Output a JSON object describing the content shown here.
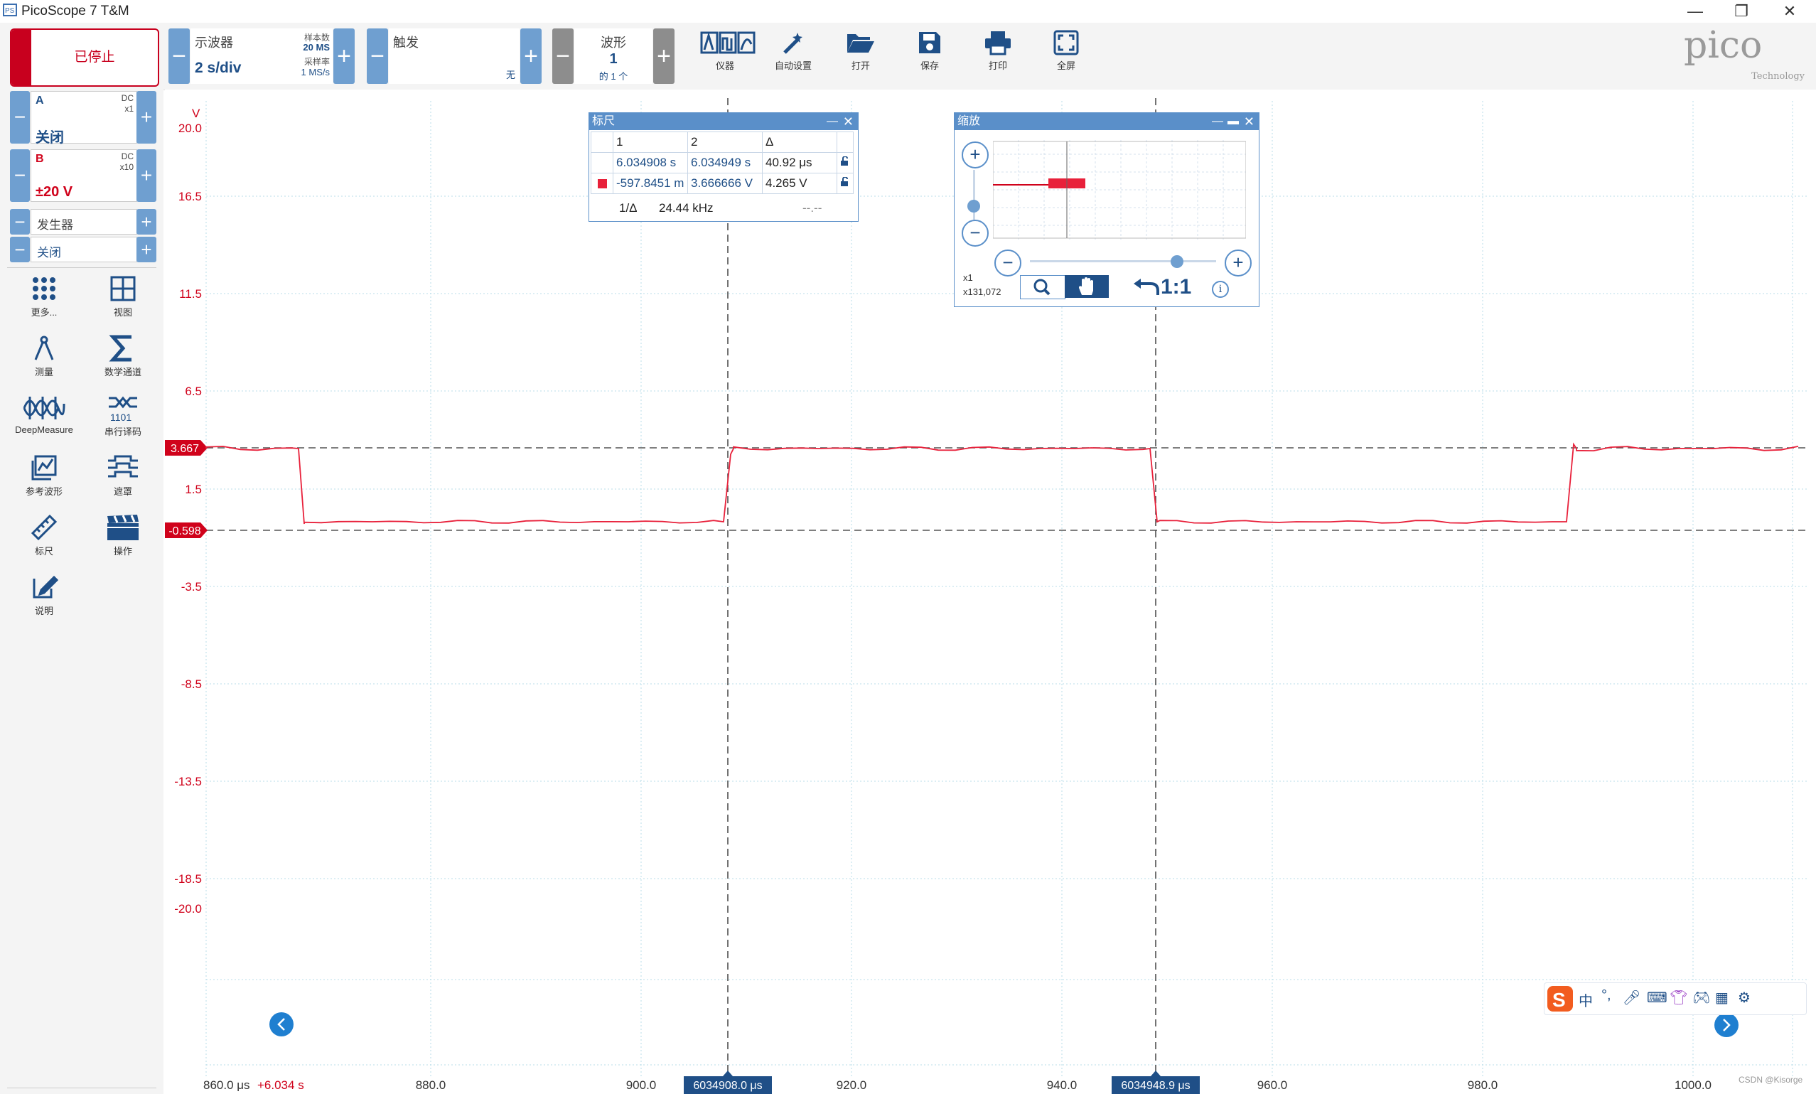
{
  "window": {
    "title": "PicoScope 7 T&M",
    "controls": [
      "—",
      "❐",
      "✕"
    ]
  },
  "toolbar": {
    "run_status": "已停止",
    "scope": {
      "mode_label": "示波器",
      "timebase": "2 s/div",
      "samples_label": "样本数",
      "samples_value": "20 MS",
      "rate_label": "采样率",
      "rate_value": "1 MS/s"
    },
    "trigger": {
      "label": "触发",
      "mode": "无"
    },
    "waveform": {
      "label": "波形",
      "index": "1",
      "of_total": "的 1 个"
    },
    "buttons": [
      {
        "label": "仪器",
        "icon": "instrument-icon"
      },
      {
        "label": "自动设置",
        "icon": "auto-setup-icon"
      },
      {
        "label": "打开",
        "icon": "open-folder-icon"
      },
      {
        "label": "保存",
        "icon": "save-icon"
      },
      {
        "label": "打印",
        "icon": "print-icon"
      },
      {
        "label": "全屏",
        "icon": "fullscreen-icon"
      }
    ],
    "minus": "−",
    "plus": "+",
    "brand": "pico",
    "brand_sub": "Technology"
  },
  "channels": {
    "a": {
      "name": "A",
      "coupling": "DC",
      "probe": "x1",
      "value": "关闭"
    },
    "b": {
      "name": "B",
      "coupling": "DC",
      "probe": "x10",
      "value": "±20 V"
    },
    "generator": {
      "label": "发生器",
      "value": "关闭"
    }
  },
  "sidebar_tools": [
    {
      "label": "更多...",
      "icon": "more-dots-icon"
    },
    {
      "label": "视图",
      "icon": "view-grid-icon"
    },
    {
      "label": "测量",
      "icon": "measure-icon"
    },
    {
      "label": "数学通道",
      "icon": "math-sigma-icon"
    },
    {
      "label": "DeepMeasure",
      "icon": "deepmeasure-icon"
    },
    {
      "label": "串行译码",
      "icon": "serial-decode-icon"
    },
    {
      "label": "参考波形",
      "icon": "reference-waveform-icon"
    },
    {
      "label": "遮罩",
      "icon": "mask-icon"
    },
    {
      "label": "标尺",
      "icon": "ruler-icon"
    },
    {
      "label": "操作",
      "icon": "actions-clapper-icon"
    },
    {
      "label": "说明",
      "icon": "notes-icon"
    }
  ],
  "plot": {
    "y_unit": "V",
    "y_ticks": [
      "20.0",
      "16.5",
      "11.5",
      "6.5",
      "1.5",
      "-3.5",
      "-8.5",
      "-13.5",
      "-18.5",
      "-20.0"
    ],
    "x_ticks": [
      "880.0",
      "900.0",
      "920.0",
      "940.0",
      "960.0",
      "980.0",
      "1000.0"
    ],
    "x_start": "860.0 μs",
    "x_offset": "+6.034 s",
    "cursor_h1_label": "3.667",
    "cursor_h2_label": "-0.598",
    "cursor_v1_label": "6034908.0 μs",
    "cursor_v2_label": "6034948.9 μs",
    "trace_color": "#e8203a"
  },
  "ruler_panel": {
    "title": "标尺",
    "headers": [
      "1",
      "2",
      "Δ"
    ],
    "row_time": [
      "6.034908 s",
      "6.034949 s",
      "40.92 μs"
    ],
    "row_volt": [
      "-597.8451 m",
      "3.666666 V",
      "4.265 V"
    ],
    "freq_label": "1/Δ",
    "freq_value": "24.44 kHz",
    "freq_other": "--.--"
  },
  "zoom_panel": {
    "title": "缩放",
    "x_zoom": "x1",
    "y_zoom": "x131,072",
    "reset": "1:1"
  },
  "watermark": "CSDN @Kisorge"
}
